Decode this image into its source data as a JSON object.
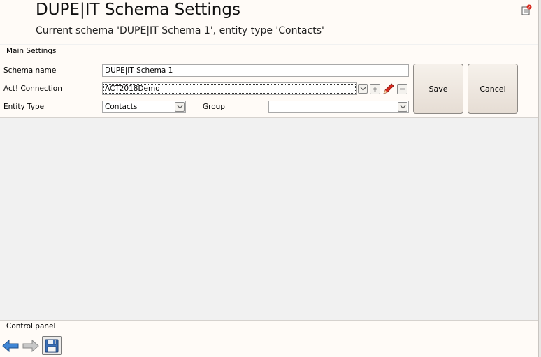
{
  "header": {
    "title": "DUPE|IT Schema Settings",
    "subtitle": "Current schema 'DUPE|IT Schema 1', entity type 'Contacts'",
    "help_icon": "help-icon"
  },
  "main_settings": {
    "section_label": "Main Settings",
    "schema_name": {
      "label": "Schema name",
      "value": "DUPE|IT Schema 1"
    },
    "connection": {
      "label": "Act! Connection",
      "value": "ACT2018Demo",
      "buttons": [
        "chevron-down-icon",
        "plus-icon",
        "pencil-icon",
        "minus-icon"
      ]
    },
    "entity_type": {
      "label": "Entity Type",
      "value": "Contacts"
    },
    "group": {
      "label": "Group",
      "value": ""
    },
    "save_label": "Save",
    "cancel_label": "Cancel"
  },
  "control_panel": {
    "label": "Control panel",
    "buttons": [
      "back-arrow-icon",
      "forward-arrow-icon",
      "save-disk-icon"
    ]
  },
  "colors": {
    "panel_background": "#fffbf7",
    "empty_background": "#f1f1f1",
    "back_arrow": "#3f86d6",
    "pencil": "#d8281c"
  }
}
